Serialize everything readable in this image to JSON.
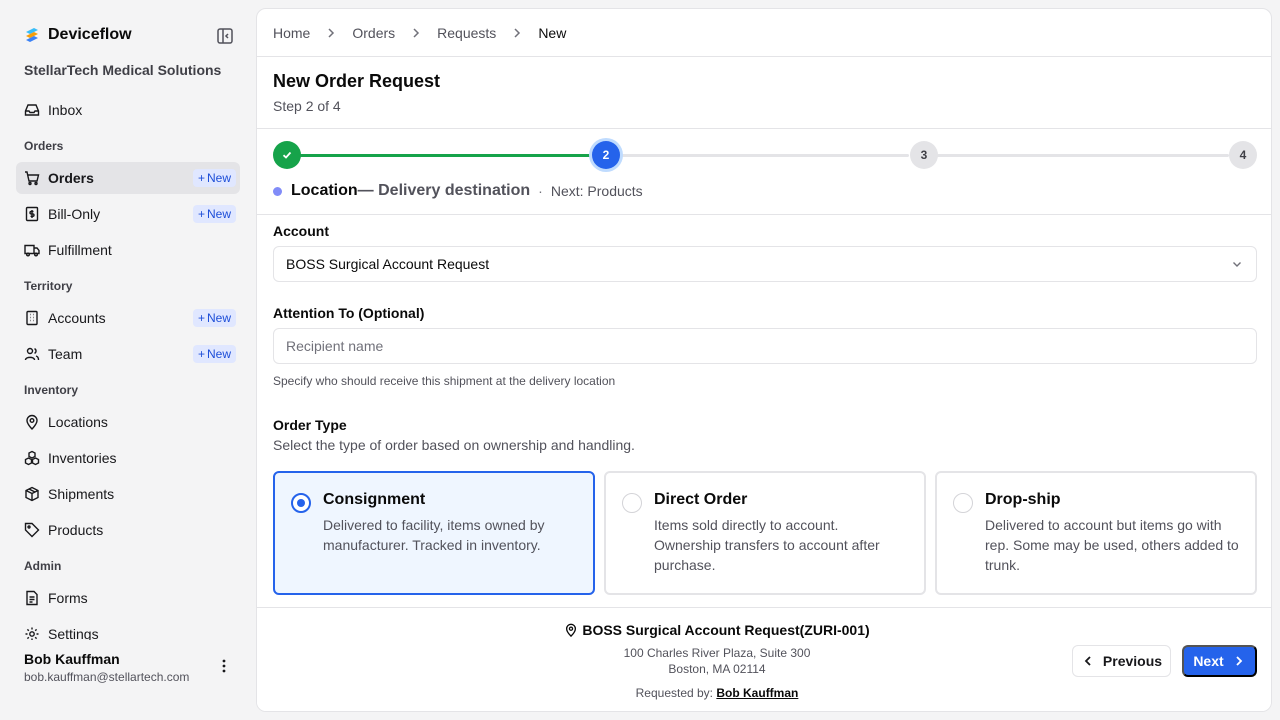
{
  "app": {
    "name": "Deviceflow",
    "org": "StellarTech Medical Solutions"
  },
  "sidebar": {
    "new_label": "New",
    "inbox": "Inbox",
    "groups": {
      "orders": "Orders",
      "territory": "Territory",
      "inventory": "Inventory",
      "admin": "Admin"
    },
    "items": {
      "orders": "Orders",
      "bill_only": "Bill-Only",
      "fulfillment": "Fulfillment",
      "accounts": "Accounts",
      "team": "Team",
      "locations": "Locations",
      "inventories": "Inventories",
      "shipments": "Shipments",
      "products": "Products",
      "forms": "Forms",
      "settings": "Settings"
    }
  },
  "user": {
    "name": "Bob Kauffman",
    "email": "bob.kauffman@stellartech.com"
  },
  "breadcrumb": [
    "Home",
    "Orders",
    "Requests",
    "New"
  ],
  "page": {
    "title": "New Order Request",
    "subtitle": "Step 2 of 4"
  },
  "stepper": {
    "total": 4,
    "current": 2,
    "steps": [
      "1",
      "2",
      "3",
      "4"
    ],
    "step_name": "Location",
    "step_desc": "— Delivery destination",
    "separator": "·",
    "next_text": "Next: Products",
    "colors": {
      "done": "#16a34a",
      "current": "#2563eb",
      "todo": "#e4e4e7"
    }
  },
  "form": {
    "account_label": "Account",
    "account_value": "BOSS Surgical Account Request",
    "attention_label": "Attention To (Optional)",
    "attention_placeholder": "Recipient name",
    "attention_hint": "Specify who should receive this shipment at the delivery location",
    "order_type_label": "Order Type",
    "order_type_sub": "Select the type of order based on ownership and handling.",
    "order_types": [
      {
        "title": "Consignment",
        "desc": "Delivered to facility, items owned by manufacturer. Tracked in inventory.",
        "selected": true
      },
      {
        "title": "Direct Order",
        "desc": "Items sold directly to account. Ownership transfers to account after purchase.",
        "selected": false
      },
      {
        "title": "Drop-ship",
        "desc": "Delivered to account but items go with rep. Some may be used, others added to trunk.",
        "selected": false
      }
    ]
  },
  "footer": {
    "location_name": "BOSS Surgical Account Request(ZURI-001)",
    "address_line1": "100 Charles River Plaza, Suite 300",
    "address_line2": "Boston, MA 02114",
    "requested_by_label": "Requested by:",
    "requested_by": "Bob Kauffman",
    "previous_label": "Previous",
    "next_label": "Next"
  },
  "colors": {
    "accent": "#2563eb",
    "success": "#16a34a",
    "badge_bg": "#e0e7ff"
  }
}
